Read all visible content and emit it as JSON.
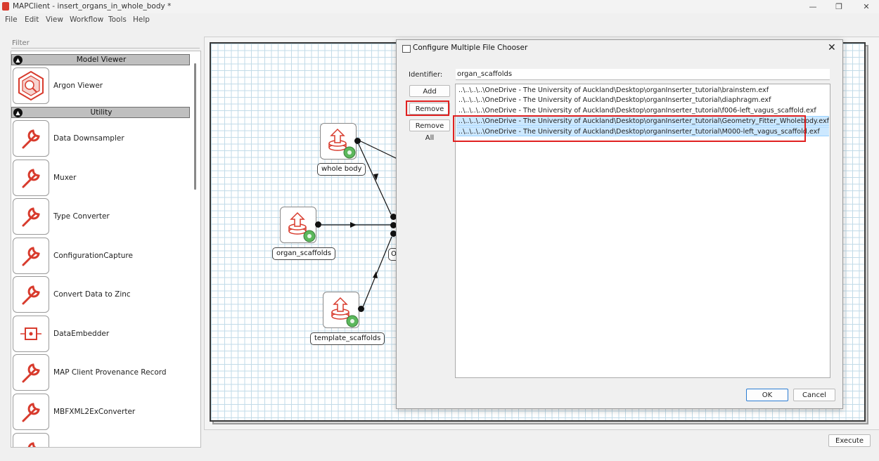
{
  "window": {
    "title": "MAPClient - insert_organs_in_whole_body *",
    "controls": {
      "minimize": "—",
      "maximize": "❐",
      "close": "✕"
    }
  },
  "menu": [
    "File",
    "Edit",
    "View",
    "Workflow",
    "Tools",
    "Help"
  ],
  "sidebar": {
    "filter_placeholder": "Filter",
    "categories": [
      {
        "label": "Model Viewer",
        "items": [
          {
            "label": "Argon Viewer",
            "icon": "argon-viewer-icon"
          }
        ]
      },
      {
        "label": "Utility",
        "items": [
          {
            "label": "Data Downsampler",
            "icon": "wrench-icon"
          },
          {
            "label": "Muxer",
            "icon": "wrench-icon"
          },
          {
            "label": "Type Converter",
            "icon": "wrench-icon"
          },
          {
            "label": "ConfigurationCapture",
            "icon": "wrench-icon"
          },
          {
            "label": "Convert Data to Zinc",
            "icon": "wrench-icon"
          },
          {
            "label": "DataEmbedder",
            "icon": "embed-icon"
          },
          {
            "label": "MAP Client Provenance Record",
            "icon": "wrench-icon"
          },
          {
            "label": "MBFXML2ExConverter",
            "icon": "wrench-icon"
          }
        ]
      }
    ]
  },
  "workflow": {
    "nodes": [
      {
        "label": "whole body",
        "icon": "file-chooser-icon"
      },
      {
        "label": "organ_scaffolds",
        "icon": "file-chooser-icon"
      },
      {
        "label": "template_scaffolds",
        "icon": "file-chooser-icon"
      }
    ],
    "partial_node_label": "O"
  },
  "dialog": {
    "title": "Configure Multiple File Chooser",
    "identifier_label": "Identifier:",
    "identifier_value": "organ_scaffolds",
    "buttons": {
      "add": "Add",
      "remove": "Remove",
      "remove_all": "Remove All",
      "ok": "OK",
      "cancel": "Cancel"
    },
    "files": [
      {
        "path": "..\\..\\..\\..\\OneDrive - The University of Auckland\\Desktop\\organInserter_tutorial\\brainstem.exf",
        "selected": false
      },
      {
        "path": "..\\..\\..\\..\\OneDrive - The University of Auckland\\Desktop\\organInserter_tutorial\\diaphragm.exf",
        "selected": false
      },
      {
        "path": "..\\..\\..\\..\\OneDrive - The University of Auckland\\Desktop\\organInserter_tutorial\\f006-left_vagus_scaffold.exf",
        "selected": false
      },
      {
        "path": "..\\..\\..\\..\\OneDrive - The University of Auckland\\Desktop\\organInserter_tutorial\\Geometry_Fitter_Wholebody.exf",
        "selected": true
      },
      {
        "path": "..\\..\\..\\..\\OneDrive - The University of Auckland\\Desktop\\organInserter_tutorial\\M000-left_vagus_scaffold.exf",
        "selected": true
      }
    ]
  },
  "execute_label": "Execute",
  "colors": {
    "accent_red": "#e02020",
    "selection": "#cce8ff",
    "grid_line": "#c2dbe8"
  }
}
